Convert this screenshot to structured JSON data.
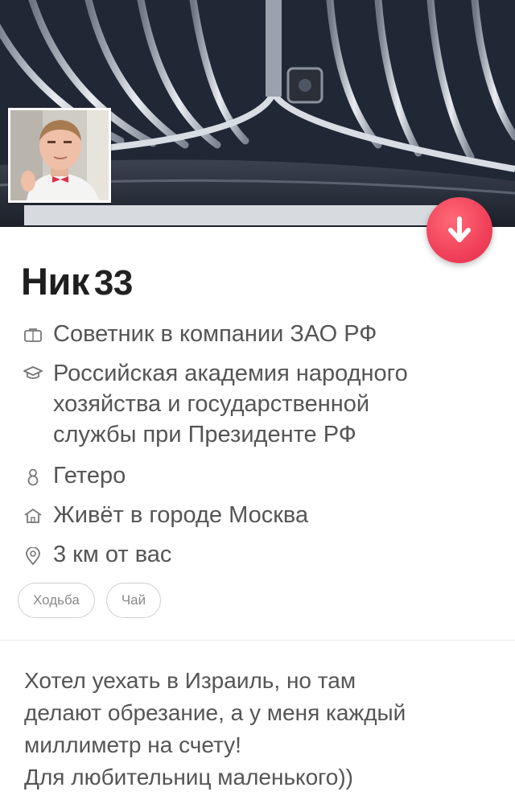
{
  "profile": {
    "name": "Ник",
    "age": "33",
    "job": "Советник в компании ЗАО РФ",
    "school_lines": [
      "Российская академия народного",
      "хозяйства и государственной",
      "службы при Президенте РФ"
    ],
    "orientation": "Гетеро",
    "city": "Живёт в городе Москва",
    "distance": "3 км от вас"
  },
  "interests": [
    "Ходьба",
    "Чай"
  ],
  "bio_lines": [
    "Хотел уехать в Израиль, но там",
    "делают обрезание, а у меня каждый",
    "миллиметр на счету!",
    "Для любительниц маленького))"
  ],
  "icons": {
    "job": "briefcase-icon",
    "school": "graduation-cap-icon",
    "orientation": "gender-icon",
    "city": "home-icon",
    "distance": "location-pin-icon",
    "action": "arrow-down-icon"
  },
  "colors": {
    "accent": "#f1415a",
    "text_primary": "#1e1e1e",
    "text_secondary": "#555555"
  }
}
